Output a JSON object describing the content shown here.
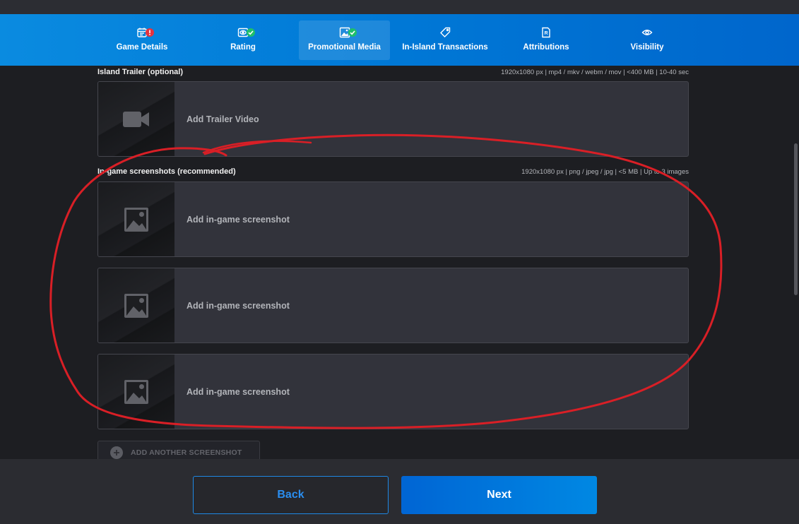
{
  "tabs": [
    {
      "label": "Game Details",
      "icon": "calendar-icon",
      "status": "error"
    },
    {
      "label": "Rating",
      "icon": "eye-box-icon",
      "status": "complete"
    },
    {
      "label": "Promotional Media",
      "icon": "image-icon",
      "status": "complete"
    },
    {
      "label": "In-Island Transactions",
      "icon": "tag-icon",
      "status": "none"
    },
    {
      "label": "Attributions",
      "icon": "document-r-icon",
      "status": "none"
    },
    {
      "label": "Visibility",
      "icon": "eye-icon",
      "status": "none"
    }
  ],
  "active_tab": "Promotional Media",
  "trailer": {
    "title": "Island Trailer (optional)",
    "spec": "1920x1080 px | mp4 / mkv / webm / mov | <400 MB | 10-40 sec",
    "slot_label": "Add Trailer Video",
    "icon": "video-camera-icon"
  },
  "screenshots": {
    "title": "In-game screenshots (recommended)",
    "spec": "1920x1080 px | png / jpeg / jpg | <5 MB | Up to 3 images",
    "slots": [
      {
        "label": "Add in-game screenshot"
      },
      {
        "label": "Add in-game screenshot"
      },
      {
        "label": "Add in-game screenshot"
      }
    ],
    "icon": "image-icon",
    "add_label": "ADD ANOTHER SCREENSHOT"
  },
  "footer": {
    "back_label": "Back",
    "next_label": "Next"
  },
  "colors": {
    "accent": "#0078d6",
    "error": "#e5333f",
    "success": "#1fbf6a",
    "annotation": "#d91f26"
  }
}
